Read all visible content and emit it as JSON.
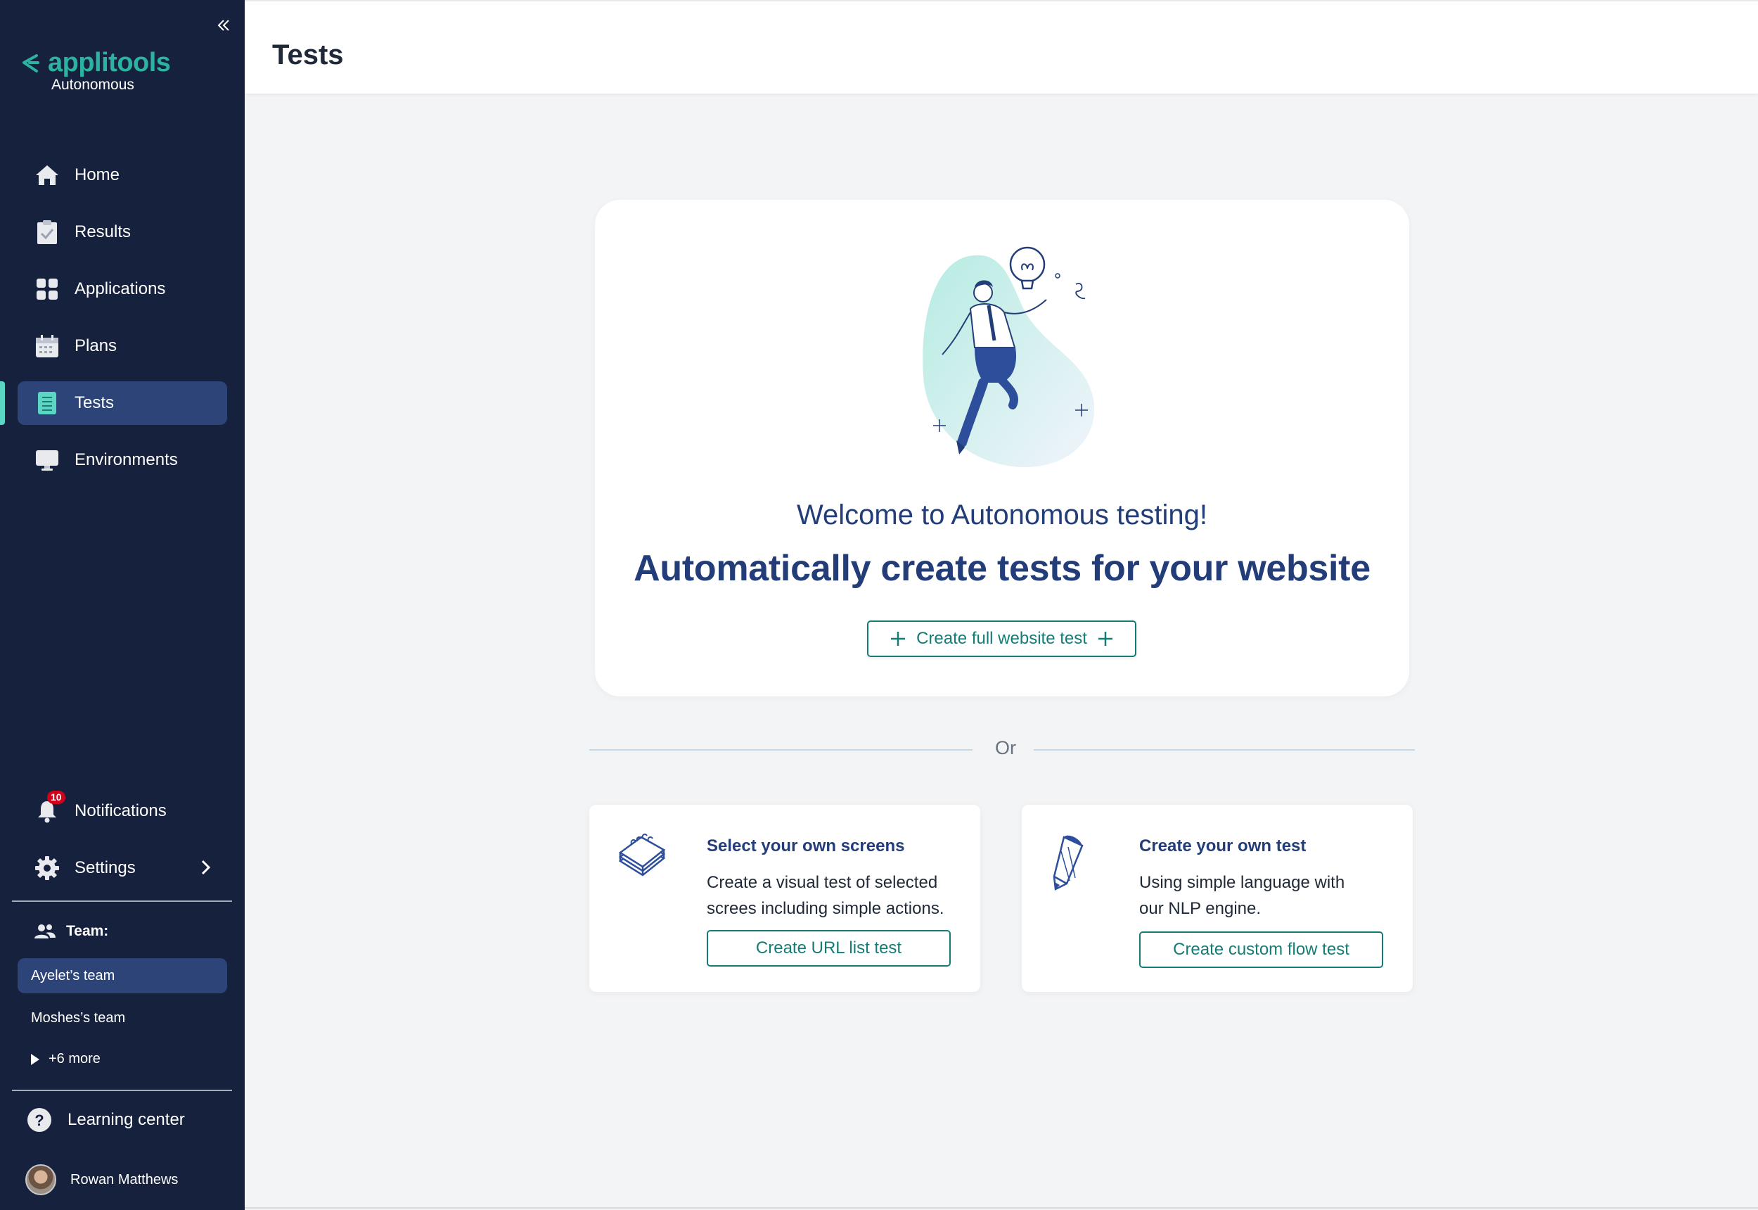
{
  "app": {
    "brand_name": "applitools",
    "brand_sub": "Autonomous",
    "brand_color": "#2bb3a0"
  },
  "sidebar": {
    "items": [
      {
        "label": "Home",
        "icon": "home-icon"
      },
      {
        "label": "Results",
        "icon": "clipboard-check-icon"
      },
      {
        "label": "Applications",
        "icon": "grid-icon"
      },
      {
        "label": "Plans",
        "icon": "calendar-icon"
      },
      {
        "label": "Tests",
        "icon": "list-doc-icon",
        "active": true
      },
      {
        "label": "Environments",
        "icon": "monitor-icon"
      }
    ],
    "notifications": {
      "label": "Notifications",
      "count": "10"
    },
    "settings": {
      "label": "Settings"
    },
    "team": {
      "heading": "Team:",
      "teams": [
        "Ayelet’s team",
        "Moshes’s team"
      ],
      "active_team": "Ayelet’s team",
      "more": "+6 more"
    },
    "learning_center": "Learning center",
    "user_name": "Rowan Matthews"
  },
  "header": {
    "title": "Tests"
  },
  "hero": {
    "welcome": "Welcome to Autonomous testing!",
    "headline": "Automatically create tests for your website",
    "button": "Create full website test"
  },
  "separator": "Or",
  "cards": [
    {
      "title": "Select your own screens",
      "description": "Create a visual test of selected screes including simple actions.",
      "button": "Create URL list test",
      "icon": "notebook-stack-icon"
    },
    {
      "title": "Create your own test",
      "description": "Using simple language with our NLP engine.",
      "button": "Create custom flow test",
      "icon": "pencil-icon"
    }
  ],
  "colors": {
    "sidebar_bg": "#16213d",
    "active_bg": "#2d4478",
    "accent": "#157c75",
    "heading": "#233d78",
    "badge": "#d0021b"
  }
}
